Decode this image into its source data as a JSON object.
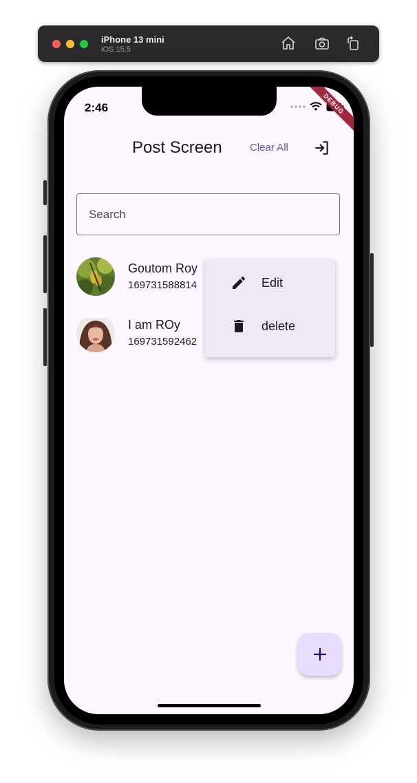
{
  "simulator": {
    "device_name": "iPhone 13 mini",
    "os_version": "iOS 15.5",
    "icons": [
      "home-icon",
      "screenshot-icon",
      "rotate-icon"
    ]
  },
  "status_bar": {
    "time": "2:46",
    "debug_banner": "DEBUG"
  },
  "app_bar": {
    "title": "Post Screen",
    "clear_all_label": "Clear All",
    "logout_icon": "logout-icon"
  },
  "search": {
    "placeholder": "Search",
    "value": ""
  },
  "posts": [
    {
      "name": "Goutom Roy",
      "subtitle": "169731588814",
      "avatar": "leaf-photo"
    },
    {
      "name": "I am ROy",
      "subtitle": "169731592462",
      "avatar": "woman-photo"
    }
  ],
  "context_menu": {
    "items": [
      {
        "label": "Edit",
        "icon": "edit-icon"
      },
      {
        "label": "delete",
        "icon": "trash-icon"
      }
    ]
  },
  "fab": {
    "icon": "add-icon"
  },
  "colors": {
    "background": "#fef7ff",
    "accent": "#6750a4",
    "menu_bg": "#f0e8f6",
    "fab_bg": "#e8ddff",
    "debug_banner": "#a4283b"
  }
}
